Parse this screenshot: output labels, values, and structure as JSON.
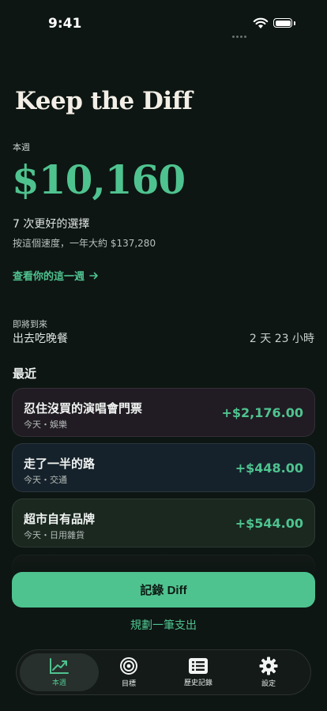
{
  "status_bar": {
    "time": "9:41"
  },
  "app": {
    "title": "Keep the Diff"
  },
  "summary": {
    "period_label": "本週",
    "amount": "$10,160",
    "choices_text": "7 次更好的選擇",
    "projection_text": "按這個速度，一年大約 $137,280",
    "week_link": "查看你的這一週"
  },
  "upcoming": {
    "label": "即將到來",
    "title": "出去吃晚餐",
    "countdown": "2 天 23 小時"
  },
  "recent": {
    "label": "最近",
    "items": [
      {
        "title": "忍住沒買的演唱會門票",
        "subtitle": "今天・娛樂",
        "amount": "+$2,176.00"
      },
      {
        "title": "走了一半的路",
        "subtitle": "今天・交通",
        "amount": "+$448.00"
      },
      {
        "title": "超市自有品牌",
        "subtitle": "今天・日用雜貨",
        "amount": "+$544.00"
      }
    ]
  },
  "actions": {
    "primary_label": "記錄 Diff",
    "secondary_label": "規劃一筆支出"
  },
  "tabbar": {
    "tabs": [
      {
        "label": "本週",
        "icon": "chart-up-icon",
        "active": true
      },
      {
        "label": "目標",
        "icon": "target-icon",
        "active": false
      },
      {
        "label": "歷史記錄",
        "icon": "list-icon",
        "active": false
      },
      {
        "label": "設定",
        "icon": "gear-icon",
        "active": false
      }
    ]
  },
  "colors": {
    "accent": "#4fc38f",
    "background": "#0d1613"
  }
}
